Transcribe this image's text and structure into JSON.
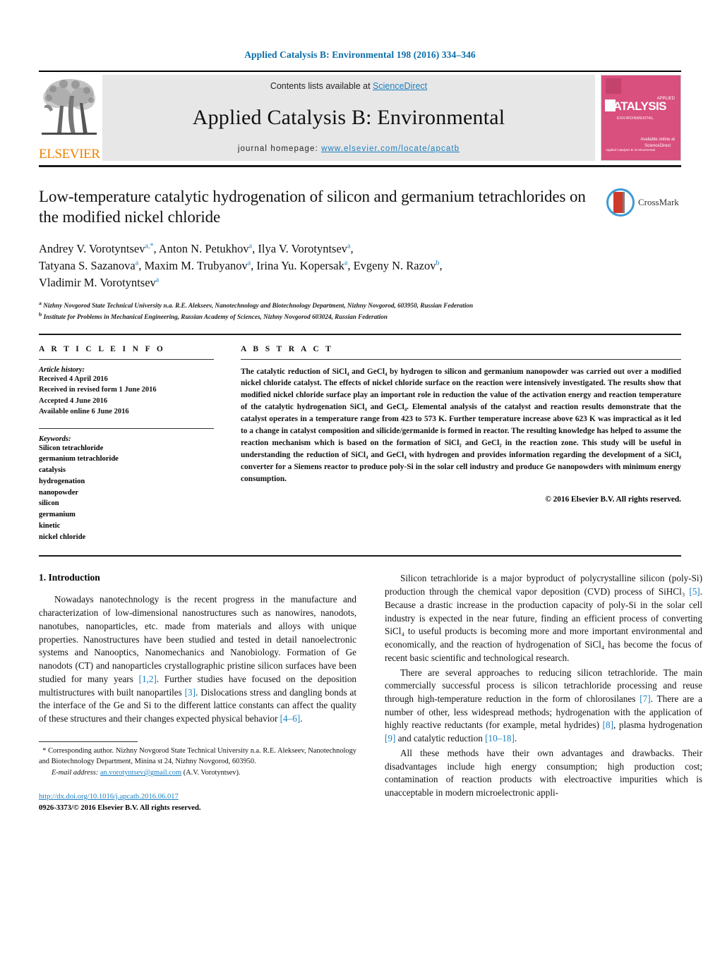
{
  "running_head": "Applied Catalysis B: Environmental 198 (2016) 334–346",
  "masthead": {
    "contents_prefix": "Contents lists available at ",
    "sciencedirect": "ScienceDirect",
    "journal_name": "Applied Catalysis B: Environmental",
    "homepage_prefix": "journal homepage: ",
    "homepage_url": "www.elsevier.com/locate/apcatb",
    "publisher": "ELSEVIER",
    "cover": {
      "title": "CATALYSIS",
      "subtitle": "ENVIRONMENTAL",
      "corner": "APPLIED",
      "footer": "Available online at",
      "footer2": "ScienceDirect",
      "bottom_left": "Applied Catalysis B: Environmental"
    },
    "accent_blue": "#1b7fc0",
    "band_gray": "#e7e7e7",
    "cover_pink": "#d94f7e",
    "elsevier_orange": "#f08100"
  },
  "article": {
    "title": "Low-temperature catalytic hydrogenation of silicon and germanium tetrachlorides on the modified nickel chloride",
    "crossmark_label": "CrossMark",
    "authors_line1": "Andrey V. Vorotyntsev",
    "authors": [
      {
        "name": "Andrey V. Vorotyntsev",
        "sup": "a,*"
      },
      {
        "name": "Anton N. Petukhov",
        "sup": "a"
      },
      {
        "name": "Ilya V. Vorotyntsev",
        "sup": "a"
      },
      {
        "name": "Tatyana S. Sazanova",
        "sup": "a"
      },
      {
        "name": "Maxim M. Trubyanov",
        "sup": "a"
      },
      {
        "name": "Irina Yu. Kopersak",
        "sup": "a"
      },
      {
        "name": "Evgeny N. Razov",
        "sup": "b"
      },
      {
        "name": "Vladimir M. Vorotyntsev",
        "sup": "a"
      }
    ],
    "affiliations": [
      {
        "sup": "a",
        "text": "Nizhny Novgorod State Technical University n.a. R.E. Alekseev, Nanotechnology and Biotechnology Department, Nizhny Novgorod, 603950, Russian Federation"
      },
      {
        "sup": "b",
        "text": "Institute for Problems in Mechanical Engineering, Russian Academy of Sciences, Nizhny Novgorod 603024, Russian Federation"
      }
    ]
  },
  "article_info": {
    "heading": "A R T I C L E   I N F O",
    "history_label": "Article history:",
    "history": [
      "Received 4 April 2016",
      "Received in revised form 1 June 2016",
      "Accepted 4 June 2016",
      "Available online 6 June 2016"
    ],
    "keywords_label": "Keywords:",
    "keywords": [
      "Silicon tetrachloride",
      "germanium tetrachloride",
      "catalysis",
      "hydrogenation",
      "nanopowder",
      "silicon",
      "germanium",
      "kinetic",
      "nickel chloride"
    ]
  },
  "abstract": {
    "heading": "A B S T R A C T",
    "text": "The catalytic reduction of SiCl₄ and GeCl₄ by hydrogen to silicon and germanium nanopowder was carried out over a modified nickel chloride catalyst. The effects of nickel chloride surface on the reaction were intensively investigated. The results show that modified nickel chloride surface play an important role in reduction the value of the activation energy and reaction temperature of the catalytic hydrogenation SiCl₄ and GeCl₄. Elemental analysis of the catalyst and reaction results demonstrate that the catalyst operates in a temperature range from 423 to 573 K. Further temperature increase above 623 K was impractical as it led to a change in catalyst composition and silicide/germanide is formed in reactor. The resulting knowledge has helped to assume the reaction mechanism which is based on the formation of SiCl₂ and GeCl₂ in the reaction zone. This study will be useful in understanding the reduction of SiCl₄ and GeCl₄ with hydrogen and provides information regarding the development of a SiCl₄ converter for a Siemens reactor to produce poly-Si in the solar cell industry and produce Ge nanopowders with minimum energy consumption.",
    "copyright": "© 2016 Elsevier B.V. All rights reserved."
  },
  "body": {
    "section_number_title": "1.  Introduction",
    "left_paragraphs": [
      "Nowadays nanotechnology is the recent progress in the manufacture and characterization of low-dimensional nanostructures such as nanowires, nanodots, nanotubes, nanoparticles, etc. made from materials and alloys with unique properties. Nanostructures have been studied and tested in detail nanoelectronic systems and Nanooptics, Nanomechanics and Nanobiology. Formation of Ge nanodots (CT) and nanoparticles crystallographic pristine silicon surfaces have been studied for many years [1,2]. Further studies have focused on the deposition multistructures with built nanopartiles [3]. Dislocations stress and dangling bonds at the interface of the Ge and Si to the different lattice constants can affect the quality of these structures and their changes expected physical behavior [4–6]."
    ],
    "right_paragraphs": [
      "Silicon tetrachloride is a major byproduct of polycrystalline silicon (poly-Si) production through the chemical vapor deposition (CVD) process of SiHCl₃ [5]. Because a drastic increase in the production capacity of poly-Si in the solar cell industry is expected in the near future, finding an efficient process of converting SiCl₄ to useful products is becoming more and more important environmental and economically, and the reaction of hydrogenation of SiCl₄ has become the focus of recent basic scientific and technological research.",
      "There are several approaches to reducing silicon tetrachloride. The main commercially successful process is silicon tetrachloride processing and reuse through high-temperature reduction in the form of chlorosilanes [7]. There are a number of other, less widespread methods; hydrogenation with the application of highly reactive reductants (for example, metal hydrides) [8], plasma hydrogenation [9] and catalytic reduction [10–18].",
      "All these methods have their own advantages and drawbacks. Their disadvantages include high energy consumption; high production cost; contamination of reaction products with electroactive impurities which is unacceptable in modern microelectronic appli-"
    ]
  },
  "footer": {
    "corresponding_star": "*",
    "corresponding_text": "Corresponding author. Nizhny Novgorod State Technical University n.a. R.E. Alekseev, Nanotechnology and Biotechnology Department, Minina st 24, Nizhny Novgorod, 603950.",
    "email_label": "E-mail address:",
    "email": "an.vorotyntsev@gmail.com",
    "email_owner": "(A.V. Vorotyntsev).",
    "doi": "http://dx.doi.org/10.1016/j.apcatb.2016.06.017",
    "issn_line": "0926-3373/© 2016 Elsevier B.V. All rights reserved."
  }
}
